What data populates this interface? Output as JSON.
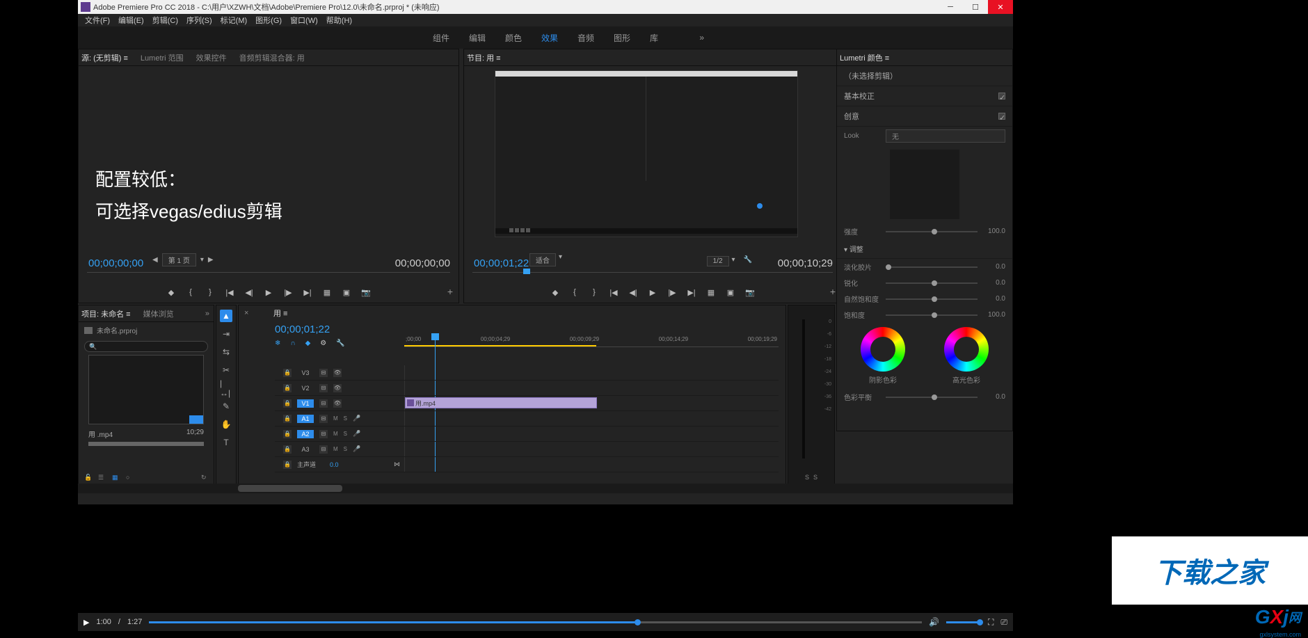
{
  "titlebar": {
    "title": "Adobe Premiere Pro CC 2018 - C:\\用户\\XZWH\\文档\\Adobe\\Premiere Pro\\12.0\\未命名.prproj * (未响应)"
  },
  "menu": {
    "file": "文件(F)",
    "edit": "编辑(E)",
    "clip": "剪辑(C)",
    "sequence": "序列(S)",
    "markers": "标记(M)",
    "graphics": "图形(G)",
    "window": "窗口(W)",
    "help": "帮助(H)"
  },
  "workspaces": {
    "assembly": "组件",
    "editing": "编辑",
    "color": "颜色",
    "effects": "效果",
    "audio": "音频",
    "graphics": "图形",
    "library": "库"
  },
  "source": {
    "tabs": {
      "source": "源: (无剪辑) ≡",
      "lumetri": "Lumetri 范围",
      "fx": "效果控件",
      "mixer": "音频剪辑混合器: 用"
    },
    "overlay_l1": "配置较低：",
    "overlay_l2": "可选择vegas/edius剪辑",
    "time_in": "00;00;00;00",
    "time_out": "00;00;00;00",
    "page_label": "第 1 页"
  },
  "program": {
    "tab": "节目: 用 ≡",
    "time_current": "00;00;01;22",
    "fit": "适合",
    "scale": "1/2",
    "time_total": "00;00;10;29"
  },
  "project": {
    "tabs": {
      "project": "项目: 未命名 ≡",
      "media": "媒体浏览"
    },
    "filename": "未命名.prproj",
    "thumb_name": "用 .mp4",
    "thumb_dur": "10;29"
  },
  "timeline": {
    "tab": "用 ≡",
    "timecode": "00;00;01;22",
    "ruler": {
      "t0": ";00;00",
      "t1": "00;00;04;29",
      "t2": "00;00;09;29",
      "t3": "00;00;14;29",
      "t4": "00;00;19;29"
    },
    "tracks": {
      "v3": "V3",
      "v2": "V2",
      "v1": "V1",
      "a1": "A1",
      "a2": "A2",
      "a3": "A3",
      "master": "主声道",
      "master_val": "0.0",
      "m": "M",
      "s": "S"
    },
    "clip": "用.mp4"
  },
  "mixer_marks": {
    "m0": "0",
    "m1": "-6",
    "m2": "-12",
    "m3": "-18",
    "m4": "-24",
    "m5": "-30",
    "m6": "-36",
    "m7": "-42"
  },
  "mixer_ss": {
    "s1": "S",
    "s2": "S"
  },
  "lumetri": {
    "tab": "Lumetri 颜色 ≡",
    "noclip": "（未选择剪辑）",
    "basic": "基本校正",
    "creative": "创意",
    "look": "Look",
    "look_val": "无",
    "intensity": "强度",
    "intensity_val": "100.0",
    "adjust": "调整",
    "faded": "淡化胶片",
    "faded_val": "0.0",
    "sharpen": "锐化",
    "sharpen_val": "0.0",
    "natsat": "自然饱和度",
    "natsat_val": "0.0",
    "sat": "饱和度",
    "sat_val": "100.0",
    "shadow_tint": "阴影色彩",
    "highlight_tint": "高光色彩",
    "color_balance": "色彩平衡",
    "cb_val": "0.0"
  },
  "watermark": "下载之家",
  "sitelogo": {
    "g": "G",
    "x": "X",
    "i": "j",
    "rest": "网",
    "sub": "gxlsystem.com"
  },
  "player": {
    "current": "1:00",
    "sep": "/",
    "total": "1:27"
  }
}
